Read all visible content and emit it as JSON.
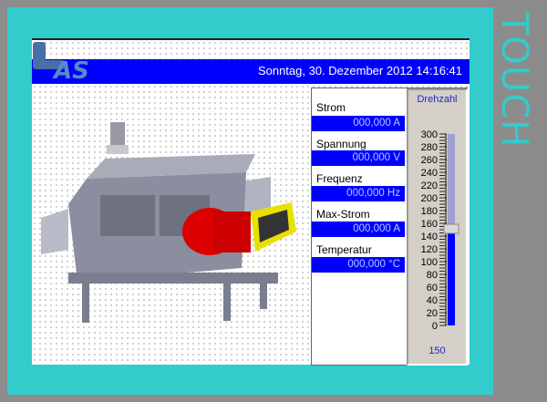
{
  "bezel": {
    "label": "TOUCH"
  },
  "header": {
    "datetime": "Sonntag, 30. Dezember 2012 14:16:41",
    "logo_text": "LAS"
  },
  "measurements": [
    {
      "label": "Strom",
      "value": "000,000 A"
    },
    {
      "label": "Spannung",
      "value": "000,000 V"
    },
    {
      "label": "Frequenz",
      "value": "000,000 Hz"
    },
    {
      "label": "Max-Strom",
      "value": "000,000 A"
    },
    {
      "label": "Temperatur",
      "value": "000,000 °C"
    }
  ],
  "gauge": {
    "title": "Drehzahl",
    "value": 150,
    "value_text": "150",
    "min": 0,
    "max": 300,
    "ticks": [
      "300",
      "280",
      "260",
      "240",
      "220",
      "200",
      "180",
      "160",
      "140",
      "120",
      "100",
      "80",
      "60",
      "40",
      "20",
      "0"
    ],
    "fill_color": "#0000ff"
  },
  "colors": {
    "bezel": "#33cccc",
    "header": "#0000ff",
    "frame": "#8c8c8c"
  }
}
